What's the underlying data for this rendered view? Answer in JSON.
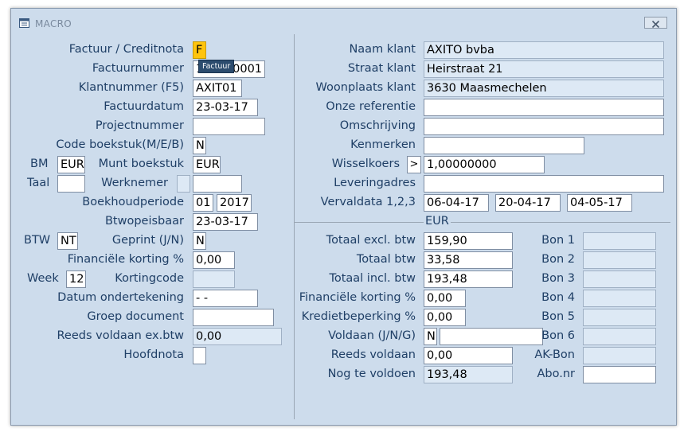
{
  "window": {
    "title": "MACRO",
    "icon": "app-window-icon",
    "close_icon": "close-x-icon"
  },
  "tooltip": "Factuur",
  "left": {
    "factuur_creditnota": {
      "label": "Factuur / Creditnota",
      "value": "F"
    },
    "factuurnummer": {
      "label": "Factuurnummer",
      "value": "170000001"
    },
    "klantnummer": {
      "label": "Klantnummer (F5)",
      "value": "AXIT01"
    },
    "factuurdatum": {
      "label": "Factuurdatum",
      "value": "23-03-17"
    },
    "projectnummer": {
      "label": "Projectnummer",
      "value": ""
    },
    "code_boekstuk": {
      "label": "Code boekstuk(M/E/B)",
      "value": "N"
    },
    "bm": {
      "label": "BM",
      "value": "EUR"
    },
    "munt_boekstuk": {
      "label": "Munt boekstuk",
      "value": "EUR"
    },
    "taal": {
      "label": "Taal",
      "value": ""
    },
    "werknemer": {
      "label": "Werknemer",
      "value1": "",
      "value2": ""
    },
    "boekhoudperiode": {
      "label": "Boekhoudperiode",
      "month": "01",
      "year": "2017"
    },
    "btwopeisbaar": {
      "label": "Btwopeisbaar",
      "value": "23-03-17"
    },
    "btw": {
      "label": "BTW",
      "value": "NT"
    },
    "geprint": {
      "label": "Geprint (J/N)",
      "value": "N"
    },
    "financiele_korting": {
      "label": "Financiële korting %",
      "value": "0,00"
    },
    "week": {
      "label": "Week",
      "value": "12"
    },
    "kortingcode": {
      "label": "Kortingcode",
      "value": ""
    },
    "datum_ondertekening": {
      "label": "Datum ondertekening",
      "value": "- -"
    },
    "groep_document": {
      "label": "Groep document",
      "value": ""
    },
    "reeds_voldaan_ex": {
      "label": "Reeds voldaan ex.btw",
      "value": "0,00"
    },
    "hoofdnota": {
      "label": "Hoofdnota",
      "value": ""
    }
  },
  "right": {
    "naam_klant": {
      "label": "Naam klant",
      "value": "AXITO bvba"
    },
    "straat_klant": {
      "label": "Straat klant",
      "value": "Heirstraat 21"
    },
    "woonplaats_klant": {
      "label": "Woonplaats klant",
      "value": "3630 Maasmechelen"
    },
    "onze_referentie": {
      "label": "Onze referentie",
      "value": ""
    },
    "omschrijving": {
      "label": "Omschrijving",
      "value": ""
    },
    "kenmerken": {
      "label": "Kenmerken",
      "value": ""
    },
    "wisselkoers": {
      "label": "Wisselkoers",
      "button": ">",
      "value": "1,00000000"
    },
    "leveringadres": {
      "label": "Leveringadres",
      "value": ""
    },
    "vervaldata": {
      "label": "Vervaldata 1,2,3",
      "d1": "06-04-17",
      "d2": "20-04-17",
      "d3": "04-05-17"
    },
    "currency": "EUR"
  },
  "totals": {
    "totaal_excl": {
      "label": "Totaal excl. btw",
      "value": "159,90"
    },
    "totaal_btw": {
      "label": "Totaal btw",
      "value": "33,58"
    },
    "totaal_incl": {
      "label": "Totaal incl. btw",
      "value": "193,48"
    },
    "financiele_korting": {
      "label": "Financiële korting %",
      "value": "0,00"
    },
    "kredietbeperking": {
      "label": "Kredietbeperking %",
      "value": "0,00"
    },
    "voldaan": {
      "label": "Voldaan (J/N/G)",
      "value": "N",
      "extra": ""
    },
    "reeds_voldaan": {
      "label": "Reeds voldaan",
      "value": "0,00"
    },
    "nog_te_voldoen": {
      "label": "Nog te voldoen",
      "value": "193,48"
    }
  },
  "bons": {
    "bon1": {
      "label": "Bon 1",
      "value": ""
    },
    "bon2": {
      "label": "Bon 2",
      "value": ""
    },
    "bon3": {
      "label": "Bon 3",
      "value": ""
    },
    "bon4": {
      "label": "Bon 4",
      "value": ""
    },
    "bon5": {
      "label": "Bon 5",
      "value": ""
    },
    "bon6": {
      "label": "Bon 6",
      "value": ""
    },
    "ak_bon": {
      "label": "AK-Bon",
      "value": ""
    },
    "abo_nr": {
      "label": "Abo.nr",
      "value": ""
    }
  }
}
